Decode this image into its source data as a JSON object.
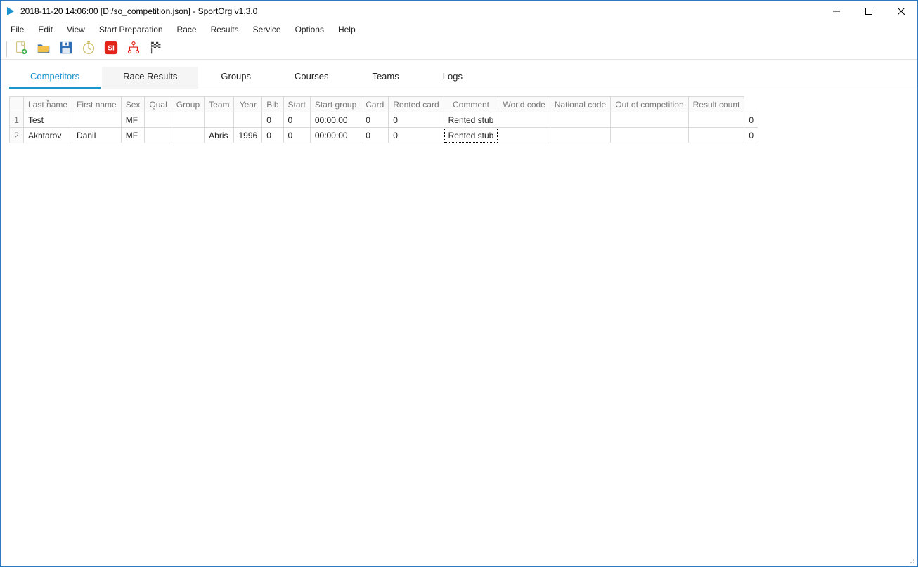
{
  "window": {
    "title": "2018-11-20 14:06:00 [D:/so_competition.json] - SportOrg v1.3.0"
  },
  "menu": {
    "items": [
      "File",
      "Edit",
      "View",
      "Start Preparation",
      "Race",
      "Results",
      "Service",
      "Options",
      "Help"
    ]
  },
  "toolbar": {
    "buttons": [
      {
        "name": "new-file-icon"
      },
      {
        "name": "open-file-icon"
      },
      {
        "name": "save-file-icon"
      },
      {
        "name": "timer-icon"
      },
      {
        "name": "sportident-icon"
      },
      {
        "name": "hierarchy-icon"
      },
      {
        "name": "finish-flag-icon"
      }
    ]
  },
  "tabs": {
    "items": [
      "Competitors",
      "Race Results",
      "Groups",
      "Courses",
      "Teams",
      "Logs"
    ],
    "active_index": 0
  },
  "table": {
    "columns": [
      "Last name",
      "First name",
      "Sex",
      "Qual",
      "Group",
      "Team",
      "Year",
      "Bib",
      "Start",
      "Start group",
      "Card",
      "Rented card",
      "Comment",
      "World code",
      "National code",
      "Out of competition",
      "Result count"
    ],
    "sorted_column_index": 0,
    "rows": [
      {
        "num": "1",
        "last": "Test",
        "first": "",
        "sex": "MF",
        "qual": "",
        "group": "",
        "team": "",
        "year": "",
        "bib": "0",
        "bib2": "0",
        "start": "00:00:00",
        "startgroup": "0",
        "card": "",
        "rented_card_num": "0",
        "rented": "Rented stub",
        "comment": "",
        "world": "",
        "national": "",
        "outcomp": "",
        "resultcount": "0"
      },
      {
        "num": "2",
        "last": "Akhtarov",
        "first": "Danil",
        "sex": "MF",
        "qual": "",
        "group": "",
        "team": "Abris",
        "year": "1996",
        "bib": "0",
        "bib2": "0",
        "start": "00:00:00",
        "startgroup": "0",
        "card": "",
        "rented_card_num": "0",
        "rented": "Rented stub",
        "comment": "",
        "world": "",
        "national": "",
        "outcomp": "",
        "resultcount": "0"
      }
    ],
    "focused_cell": {
      "row": 1,
      "col": "rented"
    }
  }
}
